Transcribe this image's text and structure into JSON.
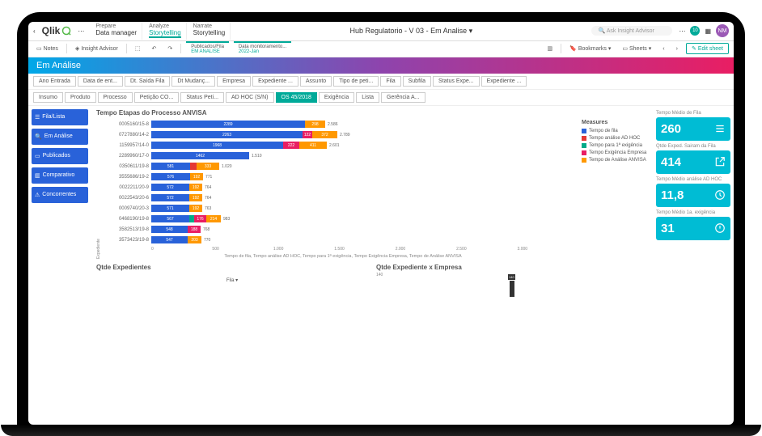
{
  "brand": "Qlik",
  "nav": {
    "prepare": {
      "label": "Prepare",
      "sub": "Data manager"
    },
    "analyze": {
      "label": "Analyze",
      "sub": "Storytelling"
    },
    "narrate": {
      "label": "Narrate",
      "sub": "Storytelling"
    }
  },
  "app_title": "Hub Regulatorio - V 03 - Em Analise",
  "search_placeholder": "Ask Insight Advisor",
  "notif_count": "10",
  "avatar": "NM",
  "toolbar": {
    "notes": "Notes",
    "insight": "Insight Advisor",
    "tab1": {
      "t": "Publicados/Fila",
      "s": "EM ANALISE"
    },
    "tab2": {
      "t": "Data monitoramento...",
      "s": "2022-Jan"
    },
    "bookmarks": "Bookmarks",
    "sheets": "Sheets",
    "edit": "Edit sheet"
  },
  "banner": "Em Análise",
  "filters_r1": [
    "Ano Entrada",
    "Data de ent...",
    "Dt. Saída Fila",
    "Dt Mudanç...",
    "Empresa",
    "Expediente ...",
    "Assunto",
    "Tipo de peti...",
    "Fila",
    "Subfila",
    "Status Expe...",
    "Expediente ..."
  ],
  "filters_r2": [
    "Insumo",
    "Produto",
    "Processo",
    "Petição CO...",
    "Status Peti...",
    "AD HOC (S/N)",
    "OS 45/2018",
    "Exigência",
    "Lista",
    "Gerência A..."
  ],
  "sidebar": [
    {
      "icon": "list",
      "label": "Fila/Lista"
    },
    {
      "icon": "search",
      "label": "Em Análise"
    },
    {
      "icon": "doc",
      "label": "Publicados"
    },
    {
      "icon": "chart",
      "label": "Comparativo"
    },
    {
      "icon": "warn",
      "label": "Concorrentes"
    }
  ],
  "chart_data": {
    "type": "bar",
    "title": "Tempo Etapas do Processo ANVISA",
    "ylabel": "Expediente",
    "xlabel": "Tempo de fila, Tempo análise AD HOC, Tempo para 1ª exigência, Tempo Exigência Empresa, Tempo de Análise ANVISA",
    "xticks": [
      "0",
      "500",
      "1.000",
      "1.500",
      "2.000",
      "2.500",
      "3.000"
    ],
    "legend_title": "Measures",
    "series_names": [
      "Tempo de fila",
      "Tempo análise AD HOC",
      "Tempo para 1ª exigência",
      "Tempo Exigência Empresa",
      "Tempo de Análise ANVISA"
    ],
    "series_colors": [
      "#2962d9",
      "#e53935",
      "#0a8",
      "#e91e63",
      "#ff9800"
    ],
    "rows": [
      {
        "cat": "0005160/15-8",
        "segs": [
          {
            "c": "b-blue",
            "v": 2289,
            "w": 190
          },
          {
            "c": "b-orange",
            "v": 298,
            "w": 25
          }
        ],
        "total": "2.586"
      },
      {
        "cat": "0727880/14-2",
        "segs": [
          {
            "c": "b-blue",
            "v": 2263,
            "w": 187
          },
          {
            "c": "b-pink",
            "v": 122,
            "w": 12
          },
          {
            "c": "b-orange",
            "v": 372,
            "w": 31
          }
        ],
        "total": "2.789"
      },
      {
        "cat": "1159957/14-0",
        "segs": [
          {
            "c": "b-blue",
            "v": 1968,
            "w": 163
          },
          {
            "c": "b-pink",
            "v": 222,
            "w": 20
          },
          {
            "c": "b-orange",
            "v": 411,
            "w": 34
          }
        ],
        "total": "2.601"
      },
      {
        "cat": "2289960/17-0",
        "segs": [
          {
            "c": "b-blue",
            "v": 1462,
            "w": 121
          }
        ],
        "total": "1.510"
      },
      {
        "cat": "0350611/19-8",
        "segs": [
          {
            "c": "b-blue",
            "v": 581,
            "w": 48
          },
          {
            "c": "b-red",
            "v": null,
            "w": 8
          },
          {
            "c": "b-orange",
            "v": 333,
            "w": 28
          }
        ],
        "total": "1.020"
      },
      {
        "cat": "3555686/19-2",
        "segs": [
          {
            "c": "b-blue",
            "v": 576,
            "w": 48
          },
          {
            "c": "b-orange",
            "v": 192,
            "w": 16
          }
        ],
        "total": "771"
      },
      {
        "cat": "0022211/20-9",
        "segs": [
          {
            "c": "b-blue",
            "v": 572,
            "w": 47
          },
          {
            "c": "b-orange",
            "v": 192,
            "w": 16
          }
        ],
        "total": "764"
      },
      {
        "cat": "0022543/20-6",
        "segs": [
          {
            "c": "b-blue",
            "v": 572,
            "w": 47
          },
          {
            "c": "b-orange",
            "v": 192,
            "w": 16
          }
        ],
        "total": "764"
      },
      {
        "cat": "0009740/20-3",
        "segs": [
          {
            "c": "b-blue",
            "v": 571,
            "w": 47
          },
          {
            "c": "b-orange",
            "v": 192,
            "w": 16
          }
        ],
        "total": "763"
      },
      {
        "cat": "0468190/19-8",
        "segs": [
          {
            "c": "b-blue",
            "v": 567,
            "w": 47
          },
          {
            "c": "b-green",
            "v": null,
            "w": 6
          },
          {
            "c": "b-pink",
            "v": 176,
            "w": 15
          },
          {
            "c": "b-orange",
            "v": 214,
            "w": 18
          }
        ],
        "total": "983"
      },
      {
        "cat": "3582513/19-8",
        "segs": [
          {
            "c": "b-blue",
            "v": 548,
            "w": 45
          },
          {
            "c": "b-pink",
            "v": 188,
            "w": 16
          }
        ],
        "total": "768"
      },
      {
        "cat": "3573423/19-8",
        "segs": [
          {
            "c": "b-blue",
            "v": 547,
            "w": 45
          },
          {
            "c": "b-orange",
            "v": 203,
            "w": 17
          }
        ],
        "total": "770"
      }
    ]
  },
  "kpis": [
    {
      "label": "Tempo Médio de Fila",
      "value": "260",
      "icon": "list"
    },
    {
      "label": "Qtde Exped. Sairam da Fila",
      "value": "414",
      "icon": "share"
    },
    {
      "label": "Tempo Médio análise AD HOC",
      "value": "11,8",
      "icon": "clock"
    },
    {
      "label": "Tempo Médio 1a. exigência",
      "value": "31",
      "icon": "alert"
    }
  ],
  "bottom": {
    "left_title": "Qtde Expedientes",
    "fila": "Fila",
    "right_title": "Qtde Expediente x Empresa",
    "right_tick": "140"
  }
}
